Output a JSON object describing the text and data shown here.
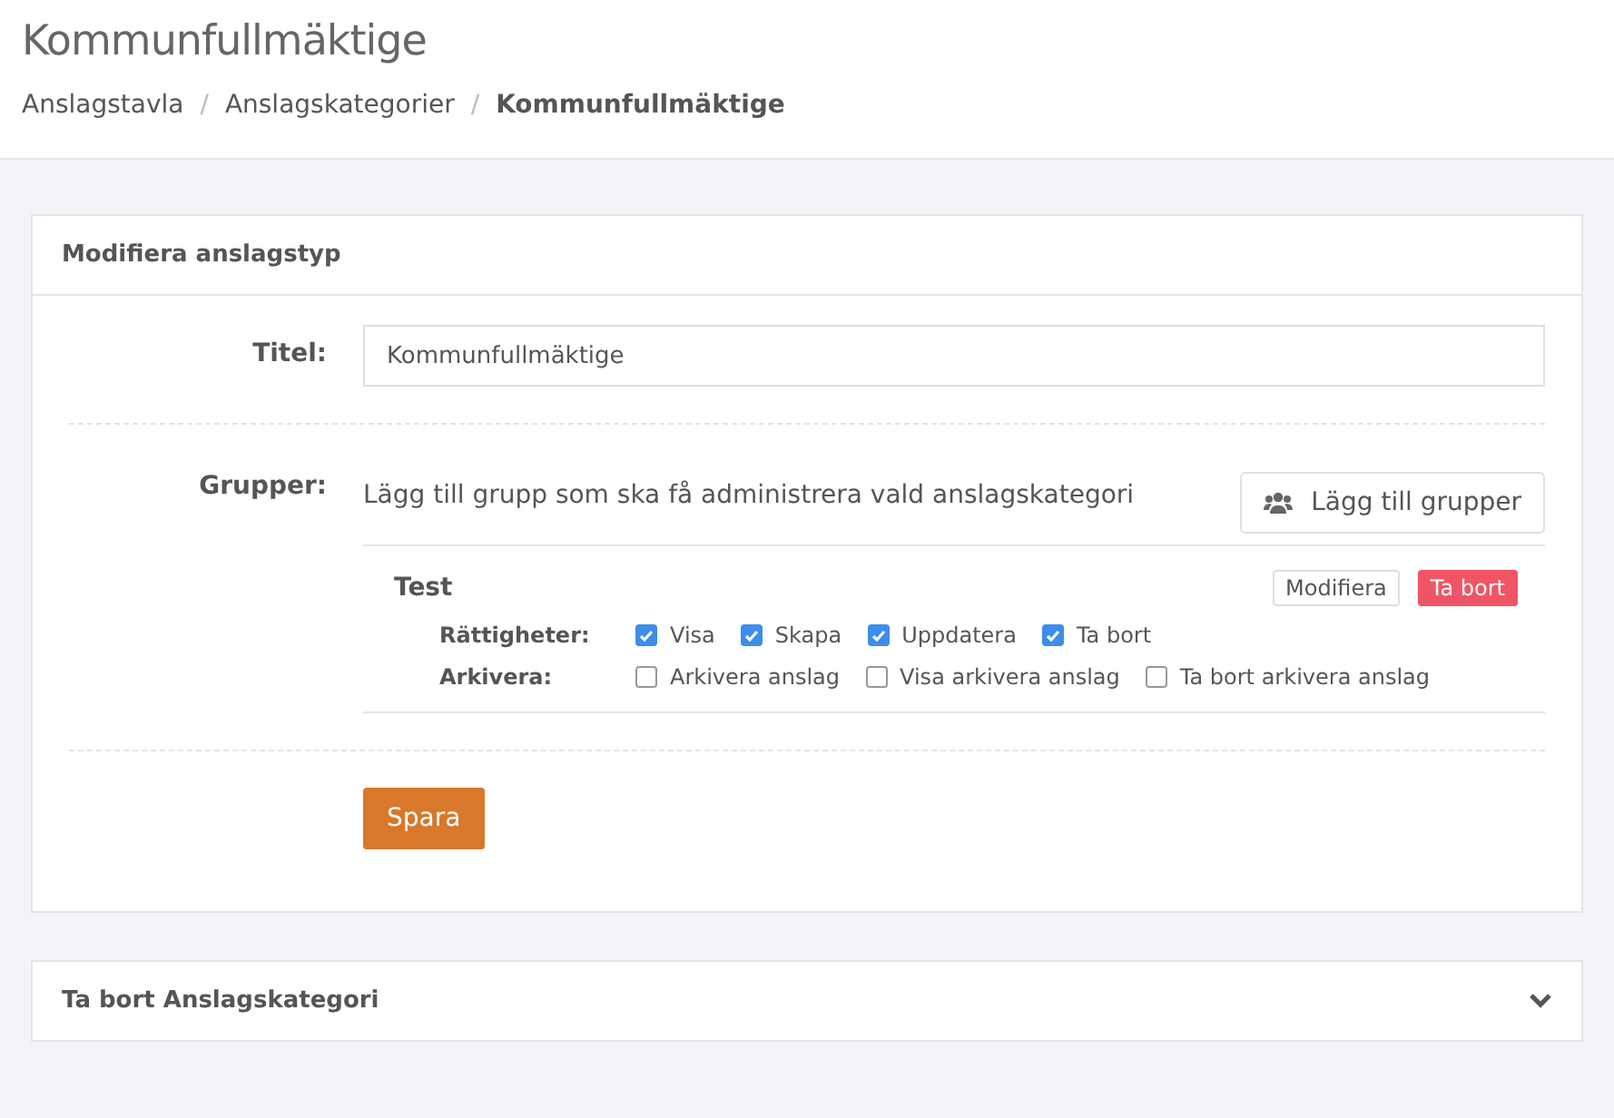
{
  "page_title": "Kommunfullmäktige",
  "breadcrumb": [
    {
      "label": "Anslagstavla",
      "current": false
    },
    {
      "label": "Anslagskategorier",
      "current": false
    },
    {
      "label": "Kommunfullmäktige",
      "current": true
    }
  ],
  "separator": "/",
  "card": {
    "title": "Modifiera anslagstyp",
    "title_field": {
      "label": "Titel:",
      "value": "Kommunfullmäktige"
    },
    "groups": {
      "label": "Grupper:",
      "hint": "Lägg till grupp som ska få administrera vald anslagskategori",
      "add_button": "Lägg till grupper",
      "items": [
        {
          "name": "Test",
          "edit_button": "Modifiera",
          "delete_button": "Ta bort",
          "permission_rows": [
            {
              "label": "Rättigheter:",
              "options": [
                {
                  "label": "Visa",
                  "checked": true
                },
                {
                  "label": "Skapa",
                  "checked": true
                },
                {
                  "label": "Uppdatera",
                  "checked": true
                },
                {
                  "label": "Ta bort",
                  "checked": true
                }
              ]
            },
            {
              "label": "Arkivera:",
              "options": [
                {
                  "label": "Arkivera anslag",
                  "checked": false
                },
                {
                  "label": "Visa arkivera anslag",
                  "checked": false
                },
                {
                  "label": "Ta bort arkivera anslag",
                  "checked": false
                }
              ]
            }
          ]
        }
      ]
    },
    "save_button": "Spara"
  },
  "collapsed_card": {
    "title": "Ta bort Anslagskategori",
    "expanded": false
  }
}
